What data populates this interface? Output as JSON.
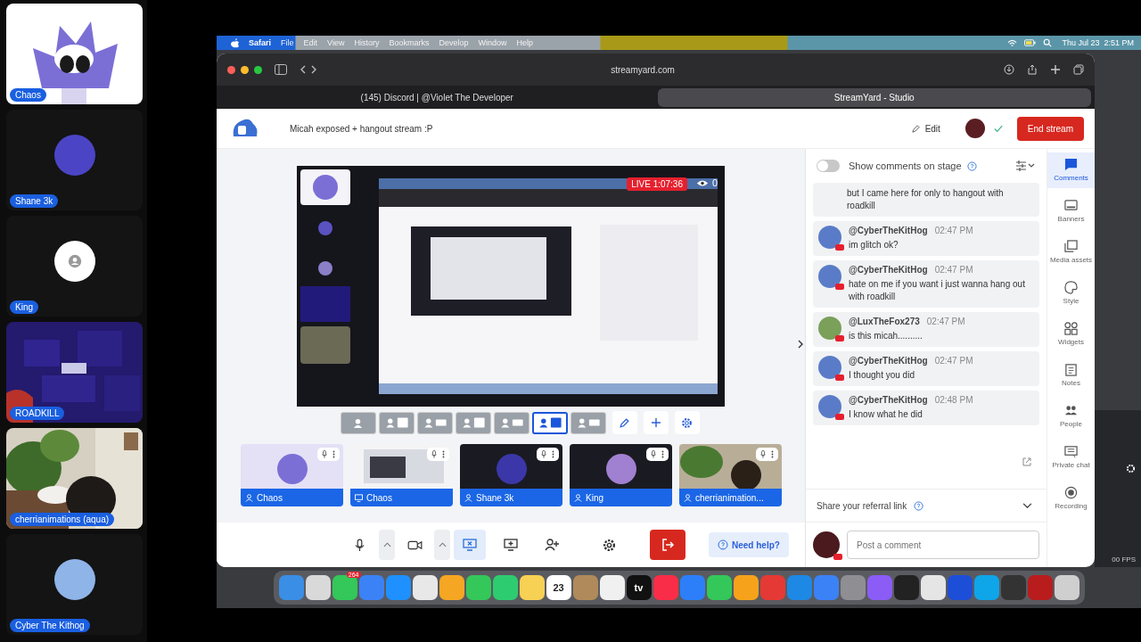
{
  "participants_column": [
    {
      "name": "Chaos",
      "kind": "picture"
    },
    {
      "name": "Shane 3k",
      "kind": "avatar"
    },
    {
      "name": "King",
      "kind": "placeholder"
    },
    {
      "name": "ROADKILL",
      "kind": "game"
    },
    {
      "name": "cherrianimations (aqua)"
    },
    {
      "name": "Cyber The Kithog",
      "kind": "avatar"
    }
  ],
  "menu_bar": {
    "app": "Safari",
    "items": [
      "File",
      "Edit",
      "View",
      "History",
      "Bookmarks",
      "Develop",
      "Window",
      "Help"
    ],
    "clock": "Thu Jul 23  2:51 PM"
  },
  "browser": {
    "address": "streamyard.com",
    "tabs": [
      {
        "label": "(145) Discord | @Violet The Developer",
        "selected": false
      },
      {
        "label": "StreamYard - Studio",
        "selected": true
      }
    ]
  },
  "studio": {
    "title": "Micah exposed + hangout stream :P",
    "edit": "Edit",
    "end_button": "End stream",
    "stage": {
      "live_badge": "LIVE 1:07:36",
      "viewers": "0"
    },
    "layouts": [
      {
        "selected": false
      },
      {
        "selected": false
      },
      {
        "selected": false
      },
      {
        "selected": false
      },
      {
        "selected": false
      },
      {
        "selected": true
      },
      {
        "selected": false
      }
    ],
    "sources": [
      {
        "name": "Chaos",
        "kind": "camera"
      },
      {
        "name": "Chaos",
        "kind": "screen"
      },
      {
        "name": "Shane 3k",
        "kind": "camera"
      },
      {
        "name": "King",
        "kind": "camera"
      },
      {
        "name": "cherrianimation...",
        "kind": "camera"
      }
    ],
    "controls": [
      {
        "kind": "mic",
        "selected": false
      },
      {
        "kind": "caret",
        "selected": false
      },
      {
        "kind": "camera",
        "selected": false
      },
      {
        "kind": "caret",
        "selected": false
      },
      {
        "kind": "share",
        "selected": true
      },
      {
        "kind": "present",
        "selected": false
      },
      {
        "kind": "invite",
        "selected": false
      },
      {
        "kind": "settings",
        "selected": false
      },
      {
        "kind": "leave",
        "selected": false
      }
    ],
    "help": "Need help?",
    "comments": {
      "toggle_label": "Show comments on stage",
      "show_on_stage": false,
      "messages": [
        {
          "text": "but I came here for only to hangout with roadkill"
        },
        {
          "author": "@CyberTheKitHog",
          "time": "02:47 PM",
          "text": "im glitch ok?"
        },
        {
          "author": "@CyberTheKitHog",
          "time": "02:47 PM",
          "text": "hate on me if you want i just wanna hang out with roadkill"
        },
        {
          "author": "@LuxTheFox273",
          "time": "02:47 PM",
          "text": "is this micah.........."
        },
        {
          "author": "@CyberTheKitHog",
          "time": "02:47 PM",
          "text": "I thought you did"
        },
        {
          "author": "@CyberTheKitHog",
          "time": "02:48 PM",
          "text": "I know what he did"
        }
      ],
      "referral": "Share your referral link",
      "placeholder": "Post a comment"
    },
    "rail": [
      {
        "label": "Comments",
        "kind": "comments",
        "selected": true
      },
      {
        "label": "Banners",
        "kind": "banners",
        "selected": false
      },
      {
        "label": "Media assets",
        "kind": "media",
        "selected": false
      },
      {
        "label": "Style",
        "kind": "style",
        "selected": false
      },
      {
        "label": "Widgets",
        "kind": "widgets",
        "selected": false
      },
      {
        "label": "Notes",
        "kind": "notes",
        "selected": false
      },
      {
        "label": "People",
        "kind": "people",
        "selected": false
      },
      {
        "label": "Private chat",
        "kind": "chat",
        "selected": false
      },
      {
        "label": "Recording",
        "kind": "recording",
        "selected": false
      }
    ]
  },
  "fps": "00 FPS",
  "dock": [
    {
      "color": "#3a8ee6"
    },
    {
      "color": "#d9d9d9"
    },
    {
      "color": "#34c759",
      "badge": "264"
    },
    {
      "color": "#3b82f6"
    },
    {
      "color": "#1e90ff"
    },
    {
      "color": "#e8e8e8"
    },
    {
      "color": "#f5a623"
    },
    {
      "color": "#34c759"
    },
    {
      "color": "#2ecc71"
    },
    {
      "color": "#f7d154"
    },
    {
      "color": "#ffffff",
      "label": "23"
    },
    {
      "color": "#b08a5a"
    },
    {
      "color": "#f0f0f0"
    },
    {
      "color": "#111111",
      "label": "tv"
    },
    {
      "color": "#fa2d48"
    },
    {
      "color": "#2d7ff9"
    },
    {
      "color": "#34c759"
    },
    {
      "color": "#f7a21b"
    },
    {
      "color": "#e53935"
    },
    {
      "color": "#1e88e5"
    },
    {
      "color": "#3b82f6"
    },
    {
      "color": "#8e8e93"
    },
    {
      "color": "#8b5cf6"
    },
    {
      "color": "#222222"
    },
    {
      "color": "#e5e5e5"
    },
    {
      "color": "#1d4ed8"
    },
    {
      "color": "#0ea5e9"
    },
    {
      "color": "#333333"
    },
    {
      "color": "#b91c1c"
    },
    {
      "color": "#cfcfcf"
    }
  ]
}
